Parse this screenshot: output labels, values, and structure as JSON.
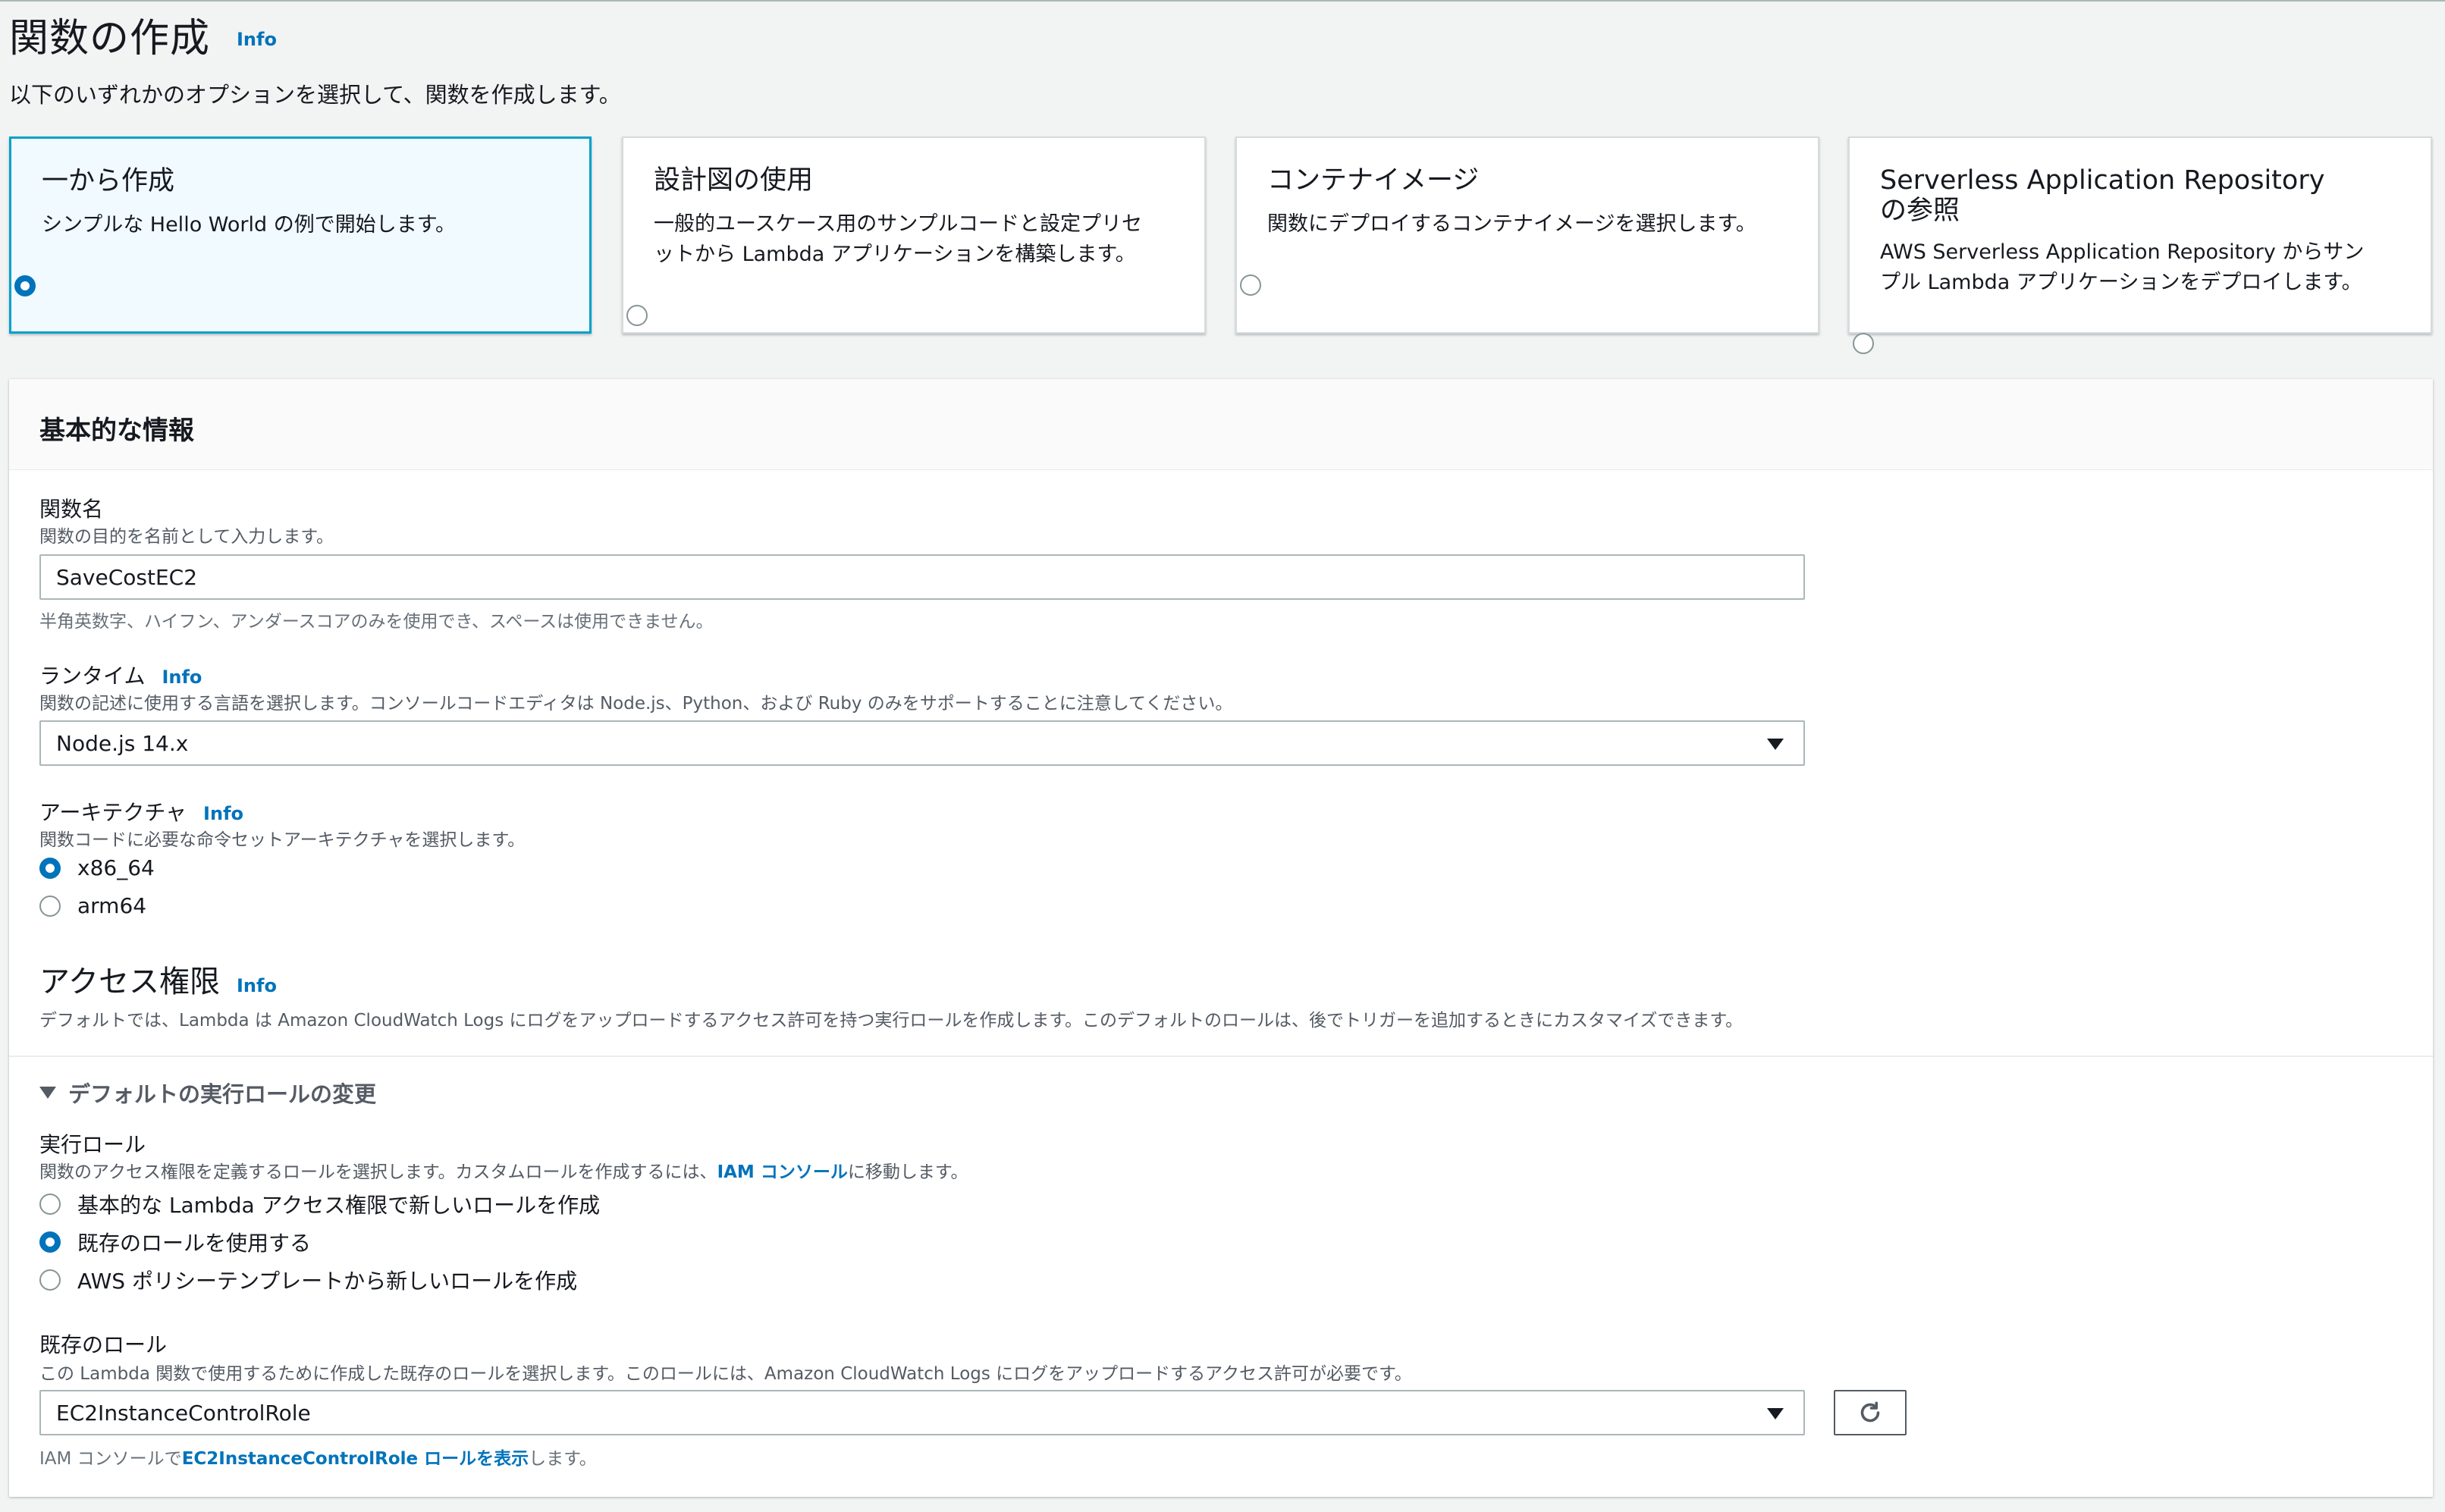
{
  "header": {
    "title": "関数の作成",
    "info": "Info",
    "description": "以下のいずれかのオプションを選択して、関数を作成します。"
  },
  "options": [
    {
      "title": "一から作成",
      "description": "シンプルな Hello World の例で開始します。",
      "selected": true
    },
    {
      "title": "設計図の使用",
      "description": "一般的ユースケース用のサンプルコードと設定プリセットから Lambda アプリケーションを構築します。",
      "selected": false
    },
    {
      "title": "コンテナイメージ",
      "description": "関数にデプロイするコンテナイメージを選択します。",
      "selected": false
    },
    {
      "title": "Serverless Application Repository の参照",
      "description": "AWS Serverless Application Repository からサンプル Lambda アプリケーションをデプロイします。",
      "selected": false
    }
  ],
  "basic": {
    "title": "基本的な情報",
    "function_name": {
      "label": "関数名",
      "description": "関数の目的を名前として入力します。",
      "value": "SaveCostEC2",
      "hint": "半角英数字、ハイフン、アンダースコアのみを使用でき、スペースは使用できません。"
    },
    "runtime": {
      "label": "ランタイム",
      "info": "Info",
      "description": "関数の記述に使用する言語を選択します。コンソールコードエディタは Node.js、Python、および Ruby のみをサポートすることに注意してください。",
      "value": "Node.js 14.x"
    },
    "architecture": {
      "label": "アーキテクチャ",
      "info": "Info",
      "description": "関数コードに必要な命令セットアーキテクチャを選択します。",
      "options": [
        {
          "label": "x86_64",
          "selected": true
        },
        {
          "label": "arm64",
          "selected": false
        }
      ]
    },
    "permissions": {
      "title": "アクセス権限",
      "info": "Info",
      "description": "デフォルトでは、Lambda は Amazon CloudWatch Logs にログをアップロードするアクセス許可を持つ実行ロールを作成します。このデフォルトのロールは、後でトリガーを追加するときにカスタマイズできます。"
    },
    "change_role": {
      "label": "デフォルトの実行ロールの変更"
    },
    "execution_role": {
      "label": "実行ロール",
      "description_before": "関数のアクセス権限を定義するロールを選択します。カスタムロールを作成するには、",
      "link": "IAM コンソール",
      "description_after": "に移動します。",
      "options": [
        {
          "label": "基本的な Lambda アクセス権限で新しいロールを作成",
          "selected": false
        },
        {
          "label": "既存のロールを使用する",
          "selected": true
        },
        {
          "label": "AWS ポリシーテンプレートから新しいロールを作成",
          "selected": false
        }
      ]
    },
    "existing_role": {
      "label": "既存のロール",
      "description": "この Lambda 関数で使用するために作成した既存のロールを選択します。このロールには、Amazon CloudWatch Logs にログをアップロードするアクセス許可が必要です。",
      "value": "EC2InstanceControlRole",
      "hint_before": "IAM コンソールで",
      "hint_link": "EC2InstanceControlRole ロールを表示",
      "hint_after": "します。"
    }
  },
  "colors": {
    "accent": "#0073bb",
    "selected_border": "#00a1c9",
    "selected_bg": "#f1faff"
  }
}
